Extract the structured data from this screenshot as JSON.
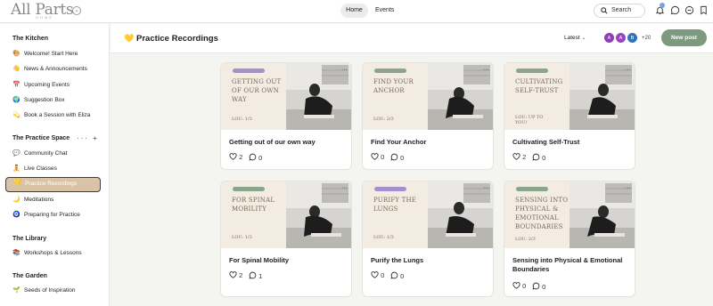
{
  "topbar": {
    "logo": "All Parts",
    "logo_sub": "HOME",
    "nav": [
      "Home",
      "Events"
    ],
    "search_label": "Search"
  },
  "sidebar": {
    "sections": [
      {
        "title": "The Kitchen",
        "items": [
          {
            "emoji": "🎨",
            "label": "Welcome! Start Here"
          },
          {
            "emoji": "👋",
            "label": "News & Announcements"
          },
          {
            "emoji": "📅",
            "label": "Upcoming Events"
          },
          {
            "emoji": "🌍",
            "label": "Suggestion Box"
          },
          {
            "emoji": "💫",
            "label": "Book a Session with Eliza"
          }
        ]
      },
      {
        "title": "The Practice Space",
        "actions": "··· +",
        "items": [
          {
            "emoji": "💬",
            "label": "Community Chat"
          },
          {
            "emoji": "🧘",
            "label": "Live Classes"
          },
          {
            "emoji": "💛",
            "label": "Practice Recordings",
            "active": true
          },
          {
            "emoji": "🌙",
            "label": "Meditations"
          },
          {
            "emoji": "🧿",
            "label": "Preparing for Practice"
          }
        ]
      },
      {
        "title": "The Library",
        "items": [
          {
            "emoji": "📚",
            "label": "Workshops & Lessons"
          }
        ]
      },
      {
        "title": "The Garden",
        "items": [
          {
            "emoji": "🌱",
            "label": "Seeds of Inspiration"
          }
        ]
      }
    ]
  },
  "header": {
    "emoji": "💛",
    "title": "Practice Recordings",
    "sort_label": "Latest",
    "avatars": [
      {
        "initial": "A",
        "color": "#8e3fb2"
      },
      {
        "initial": "A",
        "color": "#9b44c2"
      },
      {
        "initial": "B",
        "color": "#2f73b8"
      }
    ],
    "member_count": "+20",
    "new_post_label": "New post"
  },
  "cards": [
    {
      "thumb_title": "Getting out of our own way",
      "thumb_lou": "LOU: 1/3",
      "tag_color": "#a78fcf",
      "title": "Getting out of our own way",
      "likes": "2",
      "comments": "0"
    },
    {
      "thumb_title": "Find your anchor",
      "thumb_lou": "LOU: 2/3",
      "tag_color": "#8aa58a",
      "title": "Find Your Anchor",
      "likes": "0",
      "comments": "0"
    },
    {
      "thumb_title": "Cultivating Self-Trust",
      "thumb_lou": "LOU: UP TO YOU!",
      "tag_color": "#8aa58a",
      "title": "Cultivating Self-Trust",
      "likes": "2",
      "comments": "0"
    },
    {
      "thumb_title": "For Spinal Mobility",
      "thumb_lou": "LOU: 1/3",
      "tag_color": "#8aa58a",
      "title": "For Spinal Mobility",
      "likes": "2",
      "comments": "1"
    },
    {
      "thumb_title": "Purify the Lungs",
      "thumb_lou": "LOU: 1/3",
      "tag_color": "#a78fcf",
      "title": "Purify the Lungs",
      "likes": "0",
      "comments": "0"
    },
    {
      "thumb_title": "Sensing into Physical & Emotional Boundaries",
      "thumb_lou": "LOU: 2/3",
      "tag_color": "#8aa58a",
      "title": "Sensing into Physical & Emotional Boundaries",
      "likes": "0",
      "comments": "0"
    }
  ]
}
